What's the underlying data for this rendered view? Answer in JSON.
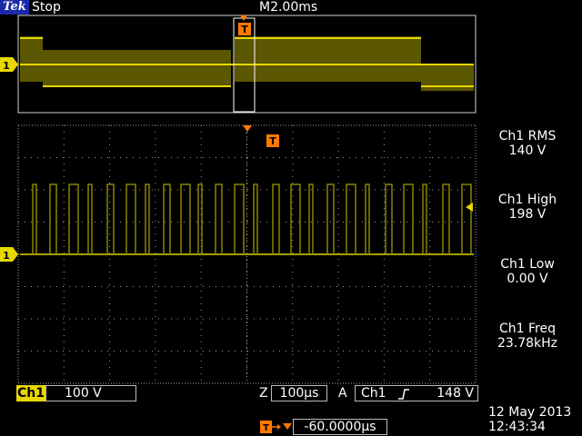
{
  "header": {
    "brand": "Tek",
    "run_state": "Stop",
    "horizontal_scale": "M2.00ms"
  },
  "overview": {
    "channel_marker": "1",
    "trigger_marker": "T"
  },
  "main": {
    "channel_marker": "1",
    "trigger_marker": "T"
  },
  "measurements": [
    {
      "name": "Ch1 RMS",
      "value": "140 V"
    },
    {
      "name": "Ch1 High",
      "value": "198 V"
    },
    {
      "name": "Ch1 Low",
      "value": "0.00 V"
    },
    {
      "name": "Ch1 Freq",
      "value": "23.78kHz"
    }
  ],
  "bottom_bar": {
    "channel_label": "Ch1",
    "channel_scale": "100 V",
    "zoom_label": "Z",
    "zoom_scale": "100µs",
    "trigger_label": "A",
    "trigger_source": "Ch1",
    "trigger_slope_icon": "rising-edge-icon",
    "trigger_level": "148 V",
    "delay_value": "-60.0000µs"
  },
  "datetime": {
    "date": "12 May 2013",
    "time": "12:43:34"
  },
  "colors": {
    "trace": "#e6d600",
    "trace_dim": "#8a8200",
    "marker": "#ff7a00",
    "grid": "#9a9a9a",
    "channel": "#e8d800"
  }
}
